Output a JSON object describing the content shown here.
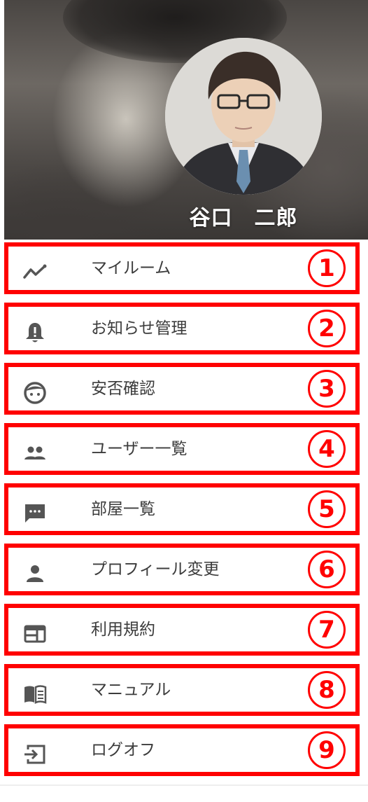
{
  "profile": {
    "name": "谷口　二郎"
  },
  "menu": {
    "items": [
      {
        "label": "マイルーム",
        "icon": "trending-icon",
        "number": "1"
      },
      {
        "label": "お知らせ管理",
        "icon": "bell-icon",
        "number": "2"
      },
      {
        "label": "安否確認",
        "icon": "face-icon",
        "number": "3"
      },
      {
        "label": "ユーザー一覧",
        "icon": "people-icon",
        "number": "4"
      },
      {
        "label": "部屋一覧",
        "icon": "chat-icon",
        "number": "5"
      },
      {
        "label": "プロフィール変更",
        "icon": "person-icon",
        "number": "6"
      },
      {
        "label": "利用規約",
        "icon": "web-icon",
        "number": "7"
      },
      {
        "label": "マニュアル",
        "icon": "book-icon",
        "number": "8"
      },
      {
        "label": "ログオフ",
        "icon": "logout-icon",
        "number": "9"
      }
    ]
  },
  "colors": {
    "highlight": "#ff0000",
    "icon": "#555555",
    "text": "#3c3c3c"
  }
}
